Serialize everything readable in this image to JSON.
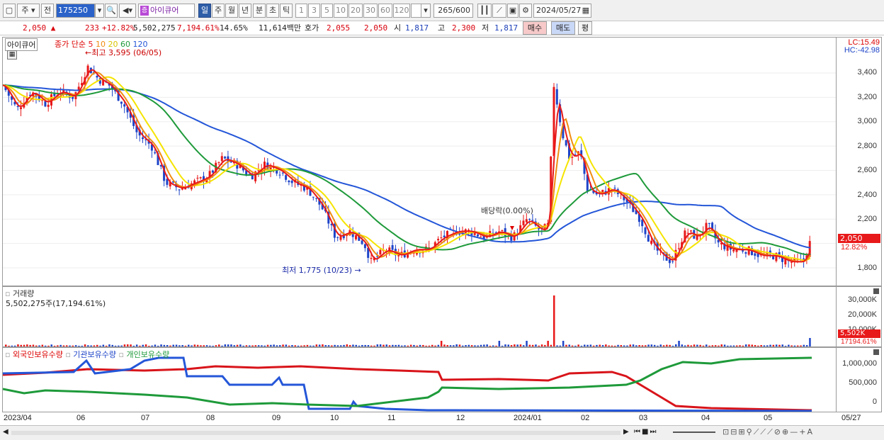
{
  "toolbar": {
    "market": "주",
    "prev": "전",
    "code": "175250",
    "stock_name": "아이큐어",
    "periods": [
      "일",
      "주",
      "월",
      "년",
      "분",
      "초",
      "틱"
    ],
    "intervals": [
      "1",
      "3",
      "5",
      "10",
      "20",
      "30",
      "60",
      "120"
    ],
    "count": "265/600",
    "date": "2024/05/27"
  },
  "quote": {
    "price": "2,050",
    "change": "233",
    "change_pct": "+12.82%",
    "volume": "5,502,275",
    "volume_pct": "7,194.61%",
    "turnover": "14.65%",
    "amount": "11,614백만",
    "bid_label": "호가",
    "ask": "2,055",
    "bid": "2,050",
    "open_label": "시",
    "open": "1,817",
    "high_label": "고",
    "high": "2,300",
    "low_label": "저",
    "low": "1,817",
    "buy": "매수",
    "sell": "매도",
    "flat": "평"
  },
  "price_panel": {
    "name": "아이큐어",
    "legend_prefix": "종가 단순",
    "ma_periods": [
      "5",
      "10",
      "20",
      "60",
      "120"
    ],
    "lc": "LC:15.49",
    "hc": "HC:-42.98",
    "high_note": "최고 3,595 (06/05)",
    "low_note": "최저 1,775 (10/23)",
    "event_note": "배당락(0.00%)",
    "y_ticks": [
      "3,400",
      "3,200",
      "3,000",
      "2,800",
      "2,600",
      "2,400",
      "2,200",
      "1,800"
    ],
    "last_price": "2,050",
    "last_pct": "12.82%"
  },
  "volume_panel": {
    "title": "거래량",
    "value": "5,502,275주(17,194.61%)",
    "y_ticks": [
      "30,000K",
      "20,000K",
      "10,000K"
    ],
    "last": "5,502K",
    "last_pct": "17194.61%"
  },
  "holding_panel": {
    "legend": [
      "외국인보유수량",
      "기관보유수량",
      "개인보유수량"
    ],
    "y_ticks": [
      "1,000,000",
      "500,000",
      "0"
    ]
  },
  "x_labels": [
    "2023/04",
    "06",
    "07",
    "08",
    "09",
    "10",
    "11",
    "12",
    "2024/01",
    "02",
    "03",
    "04",
    "05"
  ],
  "x_last": "05/27",
  "colors": {
    "ma5": "#e8191a",
    "ma10": "#f08c10",
    "ma20": "#f5e400",
    "ma60": "#1e9a3a",
    "ma120": "#2456d8",
    "up": "#e8191a",
    "down": "#1e44c8"
  }
}
